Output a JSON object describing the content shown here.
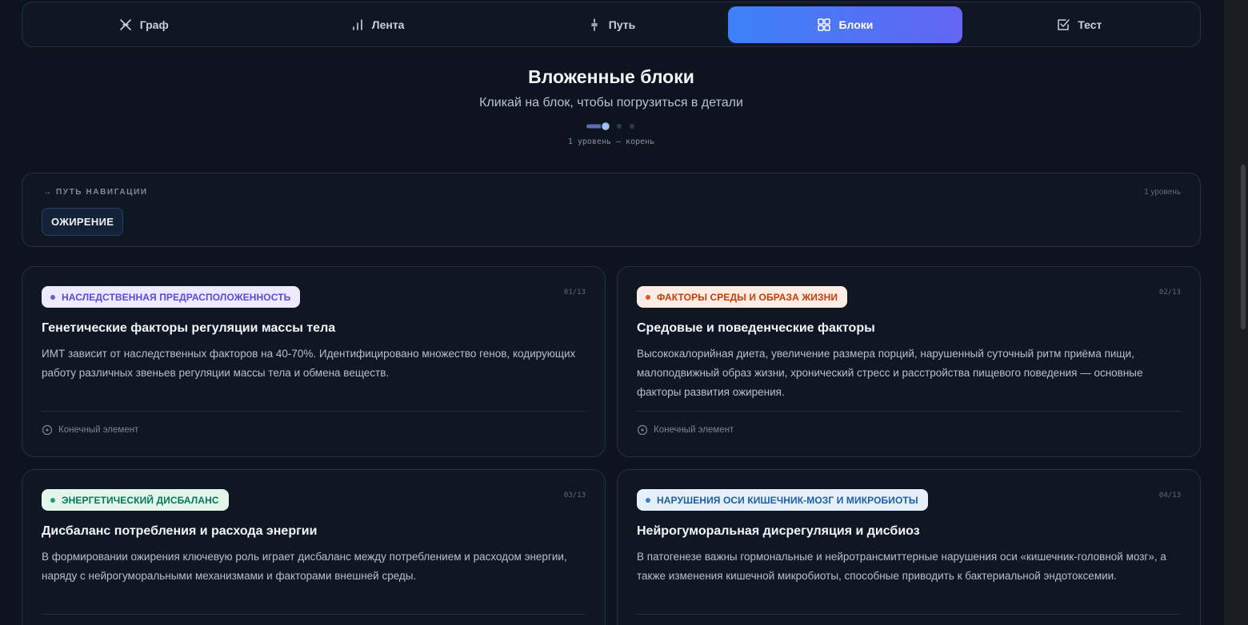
{
  "tabs": [
    {
      "label": "Граф",
      "icon": "graph-icon",
      "active": false
    },
    {
      "label": "Лента",
      "icon": "bar-chart-icon",
      "active": false
    },
    {
      "label": "Путь",
      "icon": "path-icon",
      "active": false
    },
    {
      "label": "Блоки",
      "icon": "blocks-icon",
      "active": true
    },
    {
      "label": "Тест",
      "icon": "checkbox-icon",
      "active": false
    }
  ],
  "header": {
    "title": "Вложенные блоки",
    "subtitle": "Кликай на блок, чтобы погрузиться в детали",
    "level_text": "1 уровень — корень"
  },
  "depth_indicator": {
    "current_level": 1,
    "total_levels": 3
  },
  "nav": {
    "label": "ПУТЬ НАВИГАЦИИ",
    "level": "1 уровень",
    "crumbs": [
      "ОЖИРЕНИЕ"
    ]
  },
  "cards": [
    {
      "badge": "НАСЛЕДСТВЕННАЯ ПРЕДРАСПОЛОЖЕННОСТЬ",
      "badge_color": "#5b4bd6",
      "badge_bg": "#ede9fe",
      "counter": "01/13",
      "title": "Генетические факторы регуляции массы тела",
      "desc": "ИМТ зависит от наследственных факторов на 40-70%. Идентифицировано множество генов, кодирующих работу различных звеньев регуляции массы тела и обмена веществ.",
      "footer": "Конечный элемент"
    },
    {
      "badge": "ФАКТОРЫ СРЕДЫ И ОБРАЗА ЖИЗНИ",
      "badge_color": "#c2410c",
      "badge_bg": "#fdece3",
      "counter": "02/13",
      "title": "Средовые и поведенческие факторы",
      "desc": "Высококалорийная диета, увеличение размера порций, нарушенный суточный ритм приёма пищи, малоподвижный образ жизни, хронический стресс и расстройства пищевого поведения — основные факторы развития ожирения.",
      "footer": "Конечный элемент"
    },
    {
      "badge": "ЭНЕРГЕТИЧЕСКИЙ ДИСБАЛАНС",
      "badge_color": "#047857",
      "badge_bg": "#e3f6ec",
      "counter": "03/13",
      "title": "Дисбаланс потребления и расхода энергии",
      "desc": "В формировании ожирения ключевую роль играет дисбаланс между потреблением и расходом энергии, наряду с нейрогуморальными механизмами и факторами внешней среды.",
      "footer": ""
    },
    {
      "badge": "НАРУШЕНИЯ ОСИ КИШЕЧНИК-МОЗГ И МИКРОБИОТЫ",
      "badge_color": "#1d5fa8",
      "badge_bg": "#e6f0fb",
      "counter": "04/13",
      "title": "Нейрогуморальная дисрегуляция и дисбиоз",
      "desc": "В патогенезе важны гормональные и нейротрансмиттерные нарушения оси «кишечник-головной мозг», а также изменения кишечной микробиоты, способные приводить к бактериальной эндотоксемии.",
      "footer": ""
    }
  ]
}
